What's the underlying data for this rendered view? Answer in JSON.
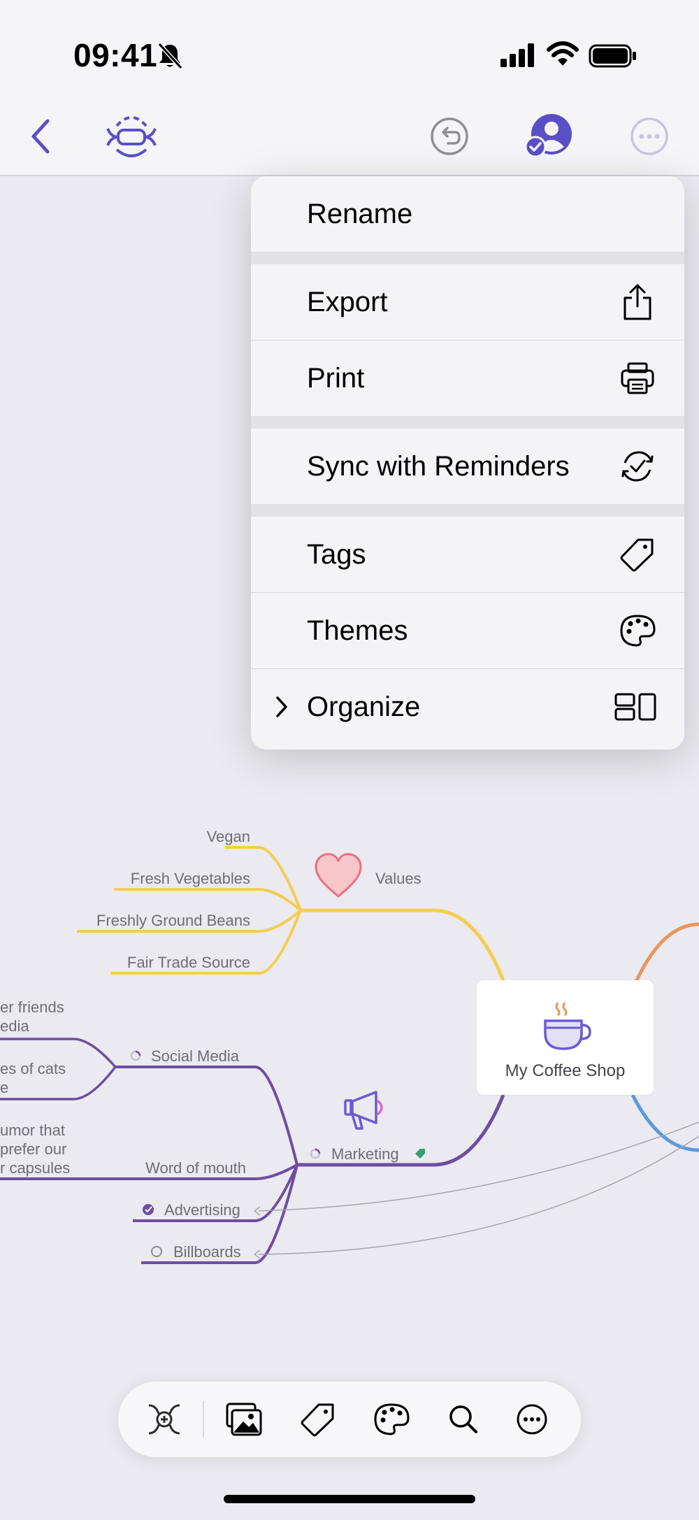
{
  "status_bar": {
    "time": "09:41",
    "icons": [
      "bell-slash-icon",
      "cellular-signal-icon",
      "wifi-icon",
      "battery-icon"
    ]
  },
  "toolbar": {
    "icons": [
      "back-chevron-icon",
      "mind-map-icon",
      "undo-icon",
      "collaborator-avatar-icon",
      "more-icon"
    ],
    "accent_color": "#5b4fc7"
  },
  "menu": {
    "items": [
      {
        "label": "Rename",
        "icon": null
      },
      {
        "label": "Export",
        "icon": "share-icon"
      },
      {
        "label": "Print",
        "icon": "printer-icon"
      },
      {
        "label": "Sync with Reminders",
        "icon": "sync-check-icon"
      },
      {
        "label": "Tags",
        "icon": "tag-icon"
      },
      {
        "label": "Themes",
        "icon": "palette-icon"
      },
      {
        "label": "Organize",
        "icon": "layout-icon",
        "has_submenu": true
      }
    ]
  },
  "mind_map": {
    "central": {
      "label": "My Coffee Shop",
      "icon": "coffee-cup-icon"
    },
    "values": {
      "label": "Values",
      "icon": "heart-icon",
      "color": "#f5cd4f",
      "children": [
        "Vegan",
        "Fresh Vegetables",
        "Freshly Ground Beans",
        "Fair Trade Source"
      ]
    },
    "marketing": {
      "label": "Marketing",
      "icon": "megaphone-icon",
      "color": "#6e4d9f",
      "children": [
        {
          "label": "Social Media",
          "status": "partial",
          "children": [
            [
              "er friends",
              "edia"
            ],
            [
              "es of cats",
              "e"
            ]
          ]
        },
        {
          "label": "Word of mouth",
          "children": [
            [
              "umor that",
              "prefer our",
              "r capsules"
            ]
          ]
        },
        {
          "label": "Advertising",
          "status": "done"
        },
        {
          "label": "Billboards",
          "status": "todo"
        }
      ]
    },
    "branch_colors": {
      "orange": "#e8965f",
      "blue": "#5a9ad9"
    }
  },
  "bottom_toolbar": {
    "icons": [
      "add-node-icon",
      "image-icon",
      "tag-icon",
      "palette-icon",
      "search-icon",
      "more-icon"
    ]
  }
}
